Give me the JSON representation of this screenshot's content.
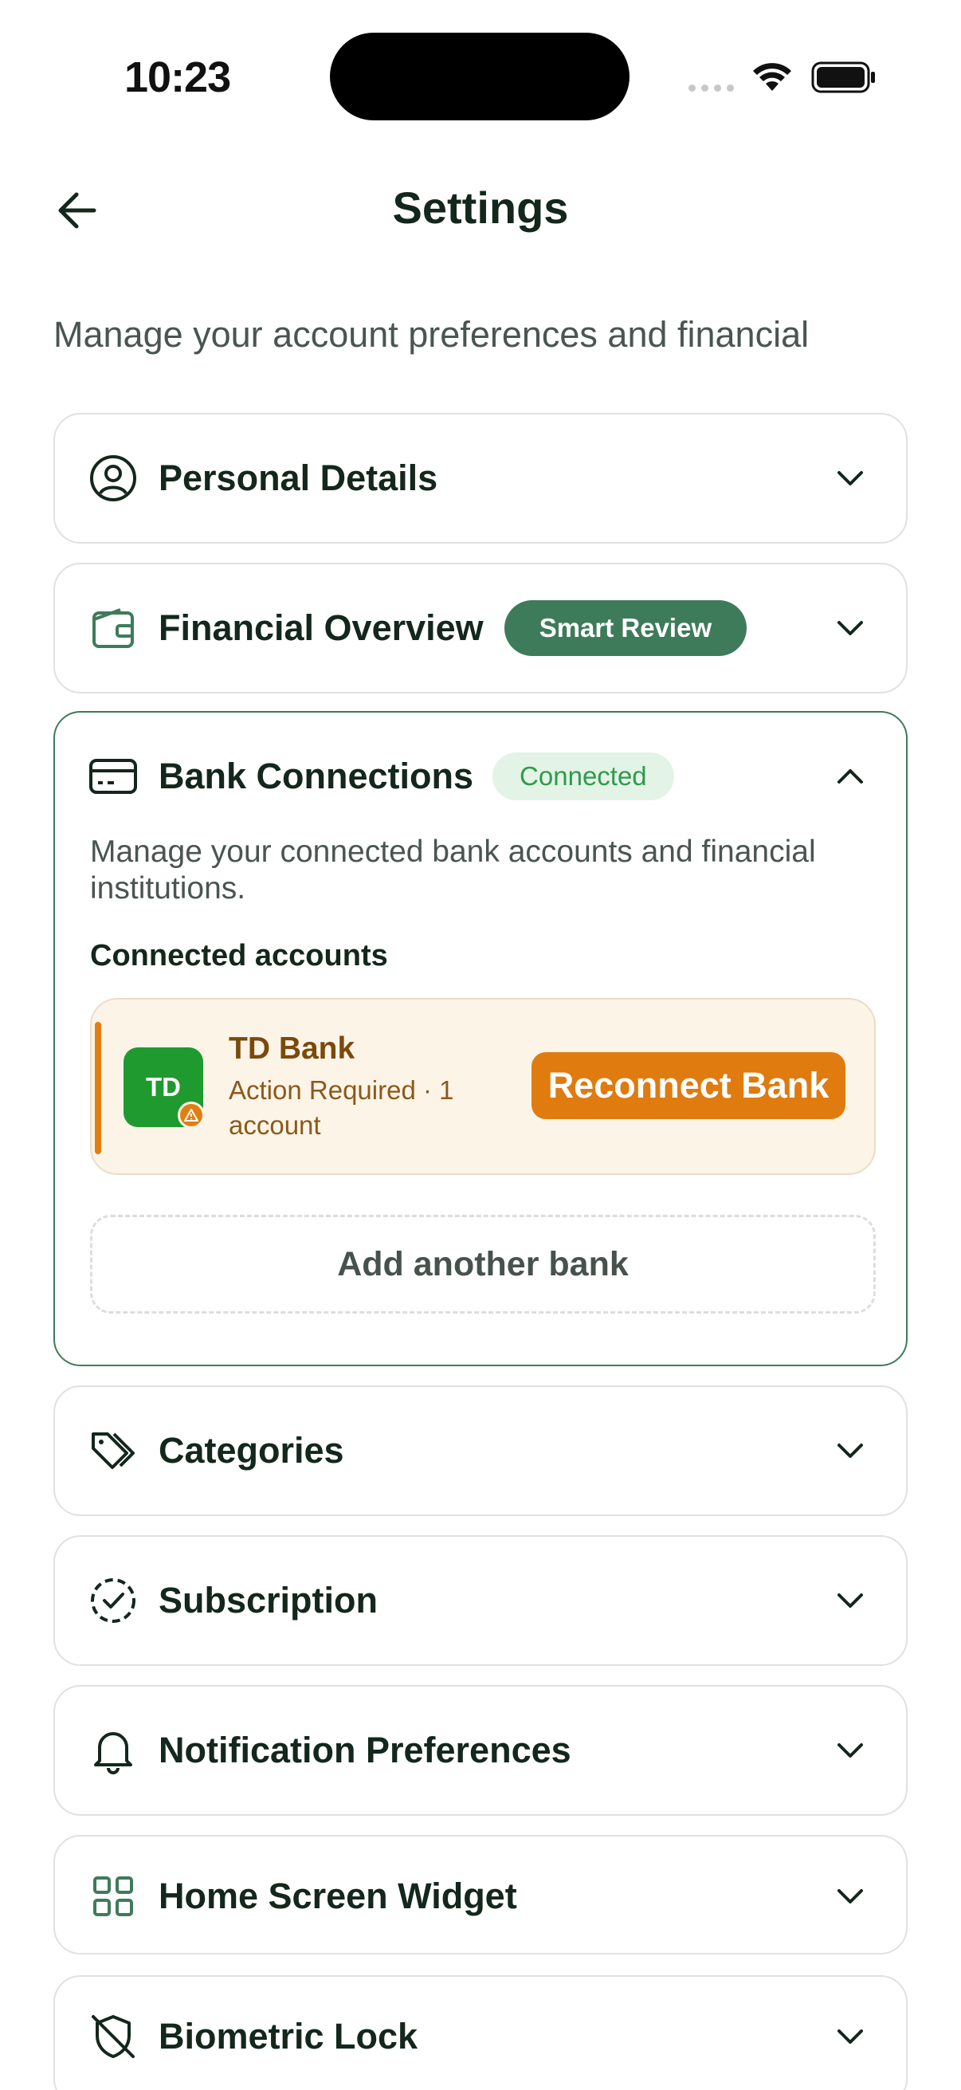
{
  "status_bar": {
    "time": "10:23"
  },
  "header": {
    "title": "Settings",
    "subtitle": "Manage your account preferences and financial"
  },
  "sections": {
    "personal": {
      "label": "Personal Details"
    },
    "financial": {
      "label": "Financial Overview",
      "badge": "Smart Review"
    },
    "bank": {
      "label": "Bank Connections",
      "badge": "Connected",
      "description": "Manage your connected bank accounts and financial institutions.",
      "connected_label": "Connected accounts",
      "accounts": [
        {
          "logo_text": "TD",
          "name": "TD Bank",
          "status": "Action Required · 1 account",
          "action": "Reconnect Bank"
        }
      ],
      "add_label": "Add another bank"
    },
    "categories": {
      "label": "Categories"
    },
    "subscription": {
      "label": "Subscription"
    },
    "notifications": {
      "label": "Notification Preferences"
    },
    "widget": {
      "label": "Home Screen Widget"
    },
    "biometric": {
      "label": "Biometric Lock"
    }
  },
  "colors": {
    "primary_green": "#3e7b5a",
    "connected_badge_bg": "#e3f3e6",
    "warning_orange": "#df7b0f",
    "bank_row_bg": "#fdf4e8",
    "td_green": "#1f9a2e"
  },
  "icons": [
    "back-arrow-icon",
    "user-circle-icon",
    "wallet-icon",
    "credit-card-icon",
    "tags-icon",
    "badge-check-icon",
    "bell-icon",
    "grid-icon",
    "shield-off-icon",
    "chevron-down-icon",
    "chevron-up-icon",
    "warning-icon"
  ]
}
